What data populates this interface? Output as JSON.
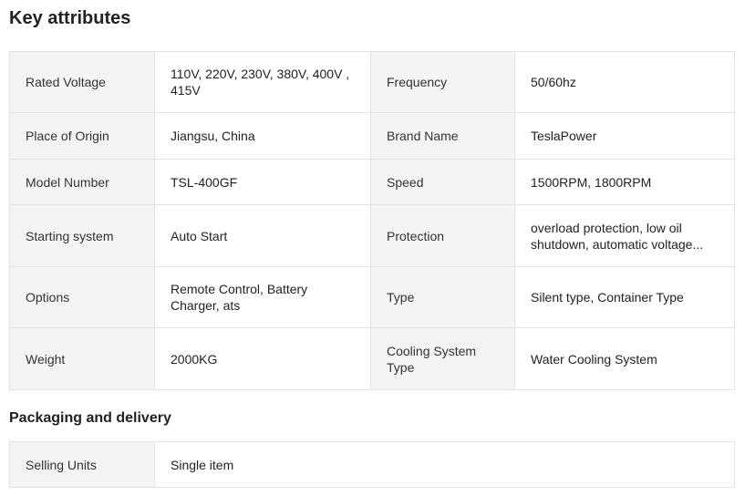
{
  "key_attributes": {
    "title": "Key attributes",
    "rows": [
      [
        {
          "label": "Rated Voltage",
          "value": "110V, 220V, 230V, 380V, 400V , 415V"
        },
        {
          "label": "Frequency",
          "value": "50/60hz"
        }
      ],
      [
        {
          "label": "Place of Origin",
          "value": "Jiangsu, China"
        },
        {
          "label": "Brand Name",
          "value": "TeslaPower"
        }
      ],
      [
        {
          "label": "Model Number",
          "value": "TSL-400GF"
        },
        {
          "label": "Speed",
          "value": "1500RPM, 1800RPM"
        }
      ],
      [
        {
          "label": "Starting system",
          "value": "Auto Start"
        },
        {
          "label": "Protection",
          "value": "overload protection, low oil shutdown, automatic voltage..."
        }
      ],
      [
        {
          "label": "Options",
          "value": "Remote Control, Battery Charger, ats"
        },
        {
          "label": "Type",
          "value": "Silent type, Container Type"
        }
      ],
      [
        {
          "label": "Weight",
          "value": "2000KG"
        },
        {
          "label": "Cooling System Type",
          "value": "Water Cooling System"
        }
      ]
    ]
  },
  "packaging": {
    "title": "Packaging and delivery",
    "rows": [
      {
        "label": "Selling Units",
        "value": "Single item"
      }
    ]
  }
}
